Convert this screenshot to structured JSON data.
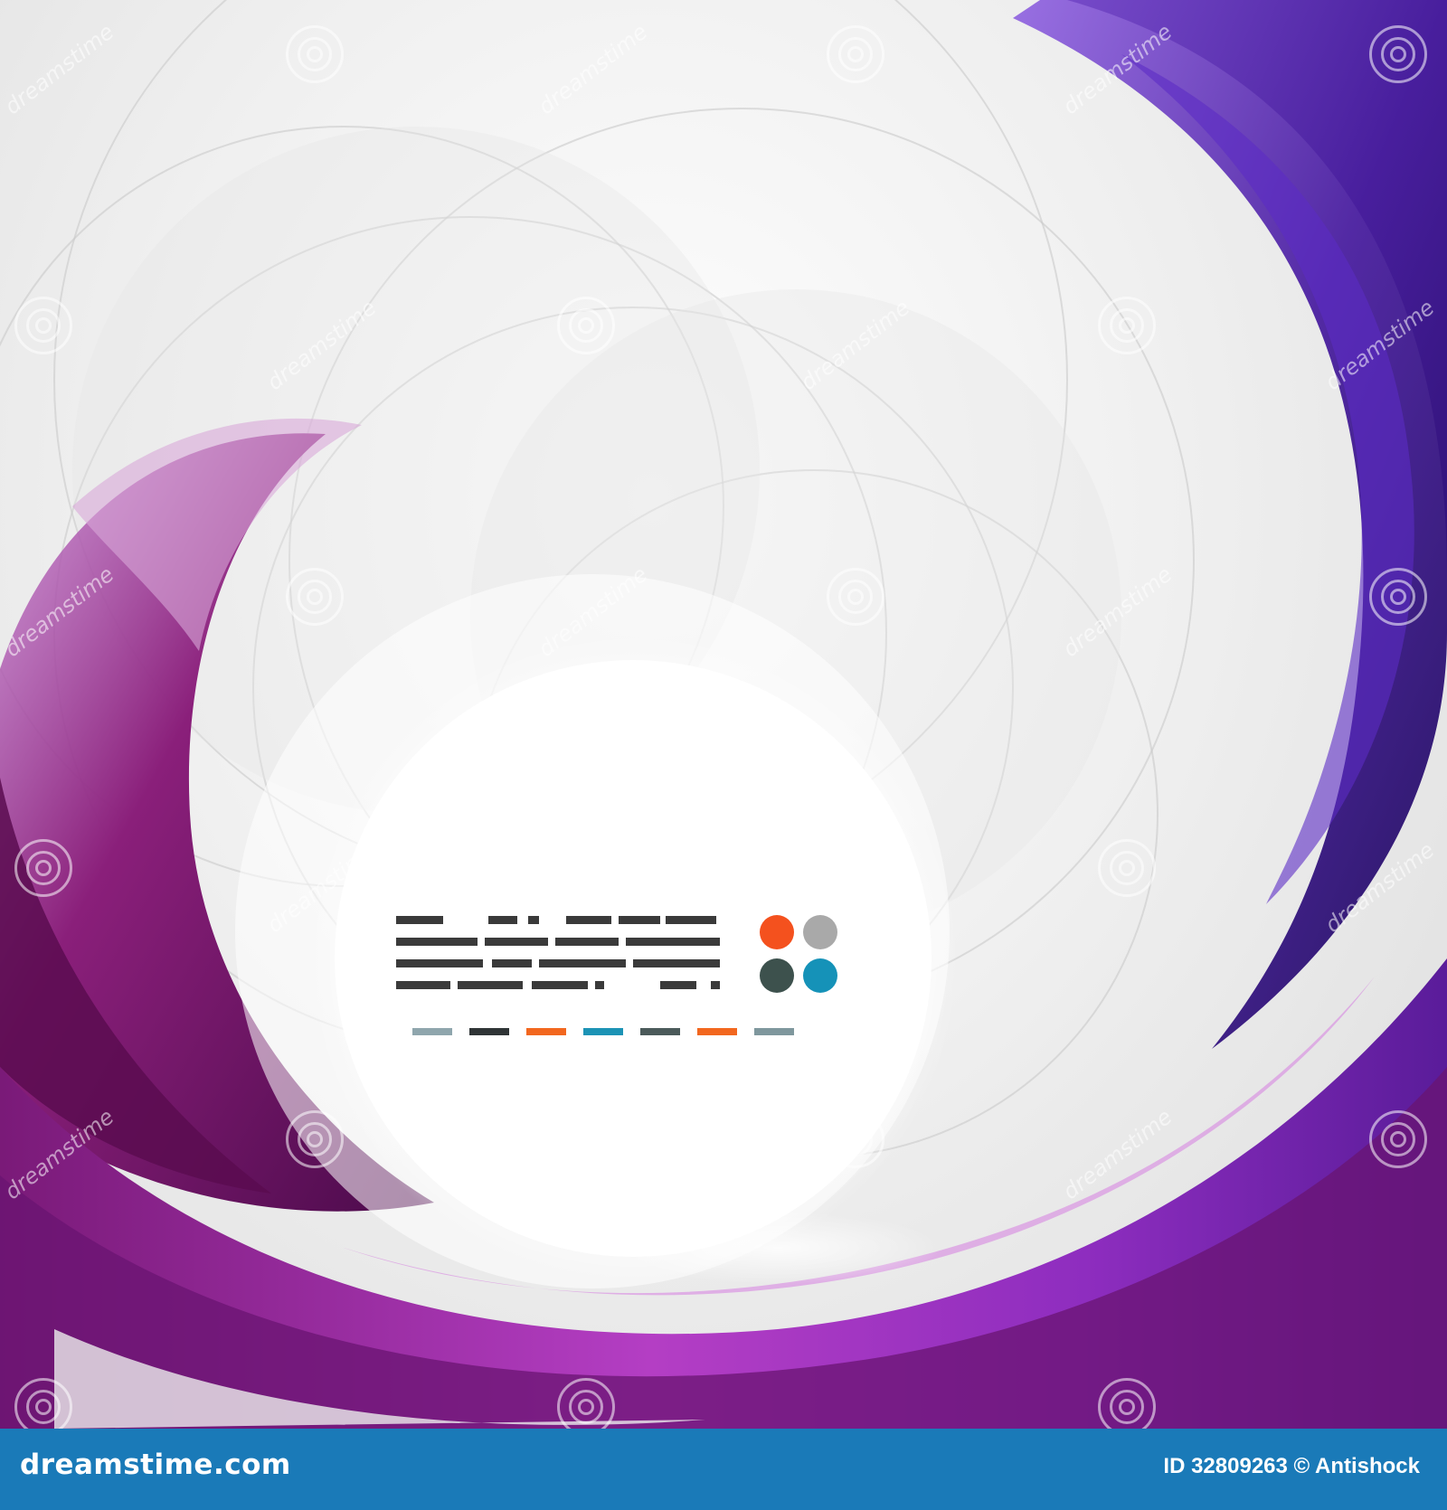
{
  "palette": {
    "dot_orange": "#f4511e",
    "dot_gray": "#a9a9a9",
    "dot_darkgreen": "#3d514d",
    "dot_teal": "#1592b8",
    "bar_colors": [
      "#8fa6ad",
      "#2f3436",
      "#f2671f",
      "#1c93b5",
      "#4b5a5a",
      "#f2671f",
      "#7f979d"
    ],
    "purple_dark": "#3c1577",
    "purple_mid": "#6a2dbf",
    "magenta": "#9b1f8f",
    "footer_bg": "#1a7ab8"
  },
  "watermark": {
    "text": "dreamstime",
    "icon": "spiral-icon"
  },
  "footer": {
    "site": "dreamstime.com",
    "credit": "ID 32809263 © Antishock"
  }
}
